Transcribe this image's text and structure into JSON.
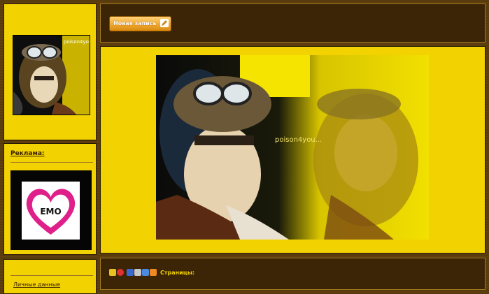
{
  "avatar": {
    "caption": "poison4you"
  },
  "ads": {
    "title": "Реклама:",
    "banner_text": "EMO"
  },
  "links": {
    "personal": "Личные данные"
  },
  "toolbar": {
    "new_post_label": "Новая запись"
  },
  "post": {
    "image_caption": "poison4you..."
  },
  "footer": {
    "pages_label": "Страницы:"
  },
  "colors": {
    "panel_yellow": "#f2d200",
    "panel_dark": "#3c2406",
    "button_orange": "#f0a830",
    "heart_pink": "#e0208a"
  },
  "icons": [
    "thumb-icon",
    "stop-icon",
    "bookmark-icon",
    "print-icon",
    "email-icon",
    "rss-icon"
  ]
}
